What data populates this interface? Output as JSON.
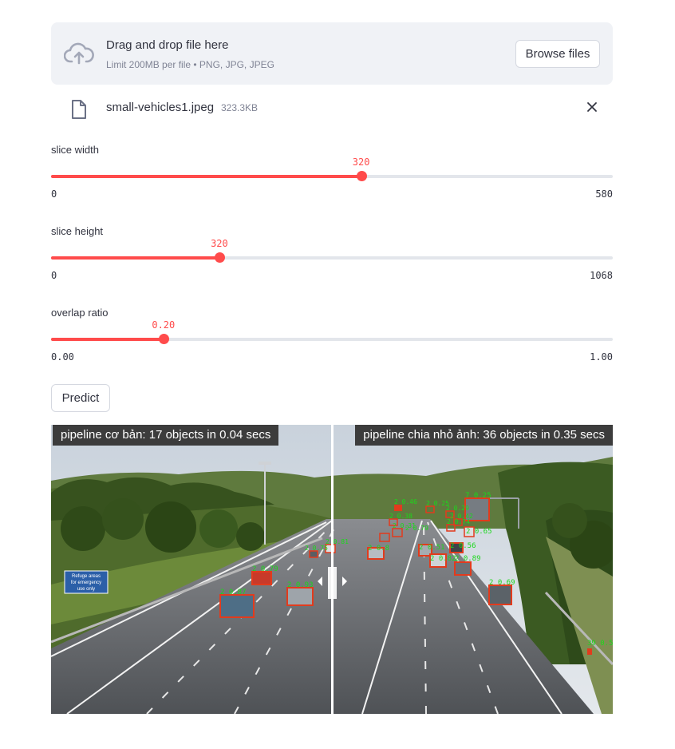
{
  "uploader": {
    "title": "Drag and drop file here",
    "limit": "Limit 200MB per file • PNG, JPG, JPEG",
    "browse_label": "Browse files",
    "icon": "cloud-upload-icon"
  },
  "file": {
    "name": "small-vehicles1.jpeg",
    "size": "323.3KB",
    "icon": "file-icon",
    "remove_icon": "close-icon"
  },
  "sliders": [
    {
      "label": "slice width",
      "value": "320",
      "min": "0",
      "max": "580",
      "fraction": 0.552
    },
    {
      "label": "slice height",
      "value": "320",
      "min": "0",
      "max": "1068",
      "fraction": 0.2996
    },
    {
      "label": "overlap ratio",
      "value": "0.20",
      "min": "0.00",
      "max": "1.00",
      "fraction": 0.2
    }
  ],
  "predict_label": "Predict",
  "comparison": {
    "left_caption": "pipeline cơ bản: 17 objects in 0.04 secs",
    "right_caption": "pipeline chia nhỏ ảnh: 36 objects in 0.35 secs",
    "sign_text": [
      "Refuge areas",
      "for emergency",
      "use only"
    ],
    "left_detections": [
      "2 0.79",
      "2 0.87",
      "2 0.93",
      "2 0.81",
      "2 0.75"
    ],
    "right_detections": [
      "7 0.25",
      "2 0.46",
      "2 0.25",
      "2 0.29",
      "2 0.42",
      "2 0.74",
      "2 0.38",
      "2 0.31",
      "2 0.79",
      "2 0.65",
      "2 0.8",
      "2 0.51",
      "2 0.56",
      "2 0.82",
      "2 0.89",
      "2 0.69",
      "39 0.5"
    ],
    "colors": {
      "box": "#e23b1d",
      "label": "#1bd81b",
      "accent": "#ff4b4b"
    }
  }
}
